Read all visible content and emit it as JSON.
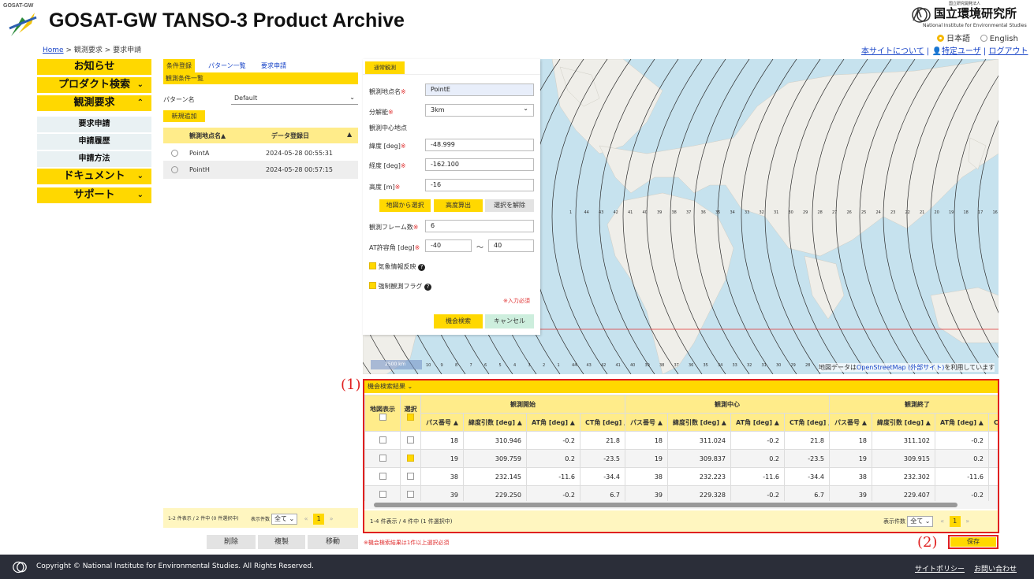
{
  "header": {
    "logo_tag": "GOSAT-GW",
    "title": "GOSAT-GW TANSO-3 Product Archive",
    "breadcrumb": {
      "home": "Home",
      "sep1": " > ",
      "crumb2": "観測要求",
      "sep2": " > ",
      "crumb3": "要求申請"
    },
    "org": {
      "small": "国立研究開発法人",
      "name": "国立環境研究所",
      "en": "National Institute for Environmental Studies"
    },
    "lang": {
      "ja": "日本語",
      "en": "English",
      "selected": "ja"
    },
    "links": {
      "about": "本サイトについて",
      "user": "特定ユーザ",
      "logout": "ログアウト",
      "sep": "|"
    }
  },
  "nav": {
    "notice": "お知らせ",
    "product_search": "プロダクト検索",
    "obs_request": "観測要求",
    "sub": [
      "要求申請",
      "申請履歴",
      "申請方法"
    ],
    "documents": "ドキュメント",
    "support": "サポート"
  },
  "left": {
    "tabs": [
      "条件登録",
      "パターン一覧",
      "要求申請"
    ],
    "section": "観測条件一覧",
    "pattern_label": "パターン名",
    "pattern_value": "Default",
    "new_button": "新規追加",
    "col_name": "観測地点名▲",
    "col_date": "データ登録日",
    "rows": [
      {
        "name": "PointA",
        "date": "2024-05-28 00:55:31"
      },
      {
        "name": "PointH",
        "date": "2024-05-28 00:57:15"
      }
    ],
    "count_text": "1-2 件表示 / 2 件中 (0 件選択中)",
    "per_page_label": "表示件数",
    "per_page_value": "全て",
    "page": "1",
    "buttons": {
      "delete": "削除",
      "copy": "複製",
      "move": "移動"
    }
  },
  "form": {
    "tab": "通常観測",
    "point_name_label": "観測地点名",
    "point_name_value": "PointE",
    "res_label": "分解能",
    "res_value": "3km",
    "center_label": "観測中心地点",
    "lat_label": "緯度 [deg]",
    "lat_value": "-48.999",
    "lon_label": "経度 [deg]",
    "lon_value": "-162.100",
    "alt_label": "高度 [m]",
    "alt_value": "-16",
    "req_mark": "※",
    "btn_map": "地図から選択",
    "btn_alt": "高度算出",
    "btn_clear": "選択を解除",
    "frames_label": "観測フレーム数",
    "frames_value": "6",
    "at_label": "AT許容角 [deg]",
    "at_min": "-40",
    "at_tilde": "〜",
    "at_max": "40",
    "weather_label": "気象情報反映",
    "force_label": "強制観測フラグ",
    "required_note": "※入力必須",
    "btn_search": "機会検索",
    "btn_cancel": "キャンセル"
  },
  "map": {
    "scale": "2500 km",
    "attribution_pre": "地図データは",
    "attribution_link": "OpenStreetMap (外部サイト)",
    "attribution_post": "を利用しています",
    "path_numbers_top": [
      "1",
      "44",
      "43",
      "42",
      "41",
      "40",
      "39",
      "38",
      "37",
      "36",
      "35",
      "34",
      "33",
      "32",
      "31",
      "30",
      "29",
      "28",
      "27",
      "26",
      "25",
      "24",
      "23",
      "22",
      "21",
      "20",
      "19",
      "18",
      "17",
      "16"
    ],
    "path_numbers_bottom": [
      "10",
      "9",
      "8",
      "7",
      "6",
      "5",
      "4",
      "3",
      "2",
      "1",
      "44",
      "43",
      "42",
      "41",
      "40",
      "39",
      "38",
      "37",
      "36",
      "35",
      "34",
      "33",
      "32",
      "31",
      "30",
      "29",
      "28"
    ]
  },
  "results": {
    "marker1": "(1)",
    "marker2": "(2)",
    "title": "機会検索結果",
    "col_map": "地図表示",
    "col_select": "選択",
    "group_start": "観測開始",
    "group_center": "観測中心",
    "group_end": "観測終了",
    "sub_headers": [
      "パス番号 ▲",
      "緯度引数 [deg] ▲",
      "AT角 [deg] ▲",
      "CT角 [deg] ▲",
      "パス番号 ▲",
      "緯度引数 [deg] ▲",
      "AT角 [deg] ▲",
      "CT角 [deg] ▲",
      "パス番号 ▲",
      "緯度引数 [deg] ▲",
      "AT角 [deg] ▲",
      "CT角"
    ],
    "rows": [
      {
        "selected": false,
        "cells": [
          "18",
          "310.946",
          "-0.2",
          "21.8",
          "18",
          "311.024",
          "-0.2",
          "21.8",
          "18",
          "311.102",
          "-0.2",
          ""
        ]
      },
      {
        "selected": true,
        "cells": [
          "19",
          "309.759",
          "0.2",
          "-23.5",
          "19",
          "309.837",
          "0.2",
          "-23.5",
          "19",
          "309.915",
          "0.2",
          ""
        ]
      },
      {
        "selected": false,
        "cells": [
          "38",
          "232.145",
          "-11.6",
          "-34.4",
          "38",
          "232.223",
          "-11.6",
          "-34.4",
          "38",
          "232.302",
          "-11.6",
          ""
        ]
      },
      {
        "selected": false,
        "cells": [
          "39",
          "229.250",
          "-0.2",
          "6.7",
          "39",
          "229.328",
          "-0.2",
          "6.7",
          "39",
          "229.407",
          "-0.2",
          ""
        ]
      }
    ],
    "count_text": "1-4 件表示 / 4 件中 (1 件選択中)",
    "per_page_label": "表示件数",
    "per_page_value": "全て",
    "page": "1",
    "note": "※機会検索結果は1件以上選択必須",
    "save": "保存"
  },
  "footer": {
    "copyright": "Copyright © National Institute for Environmental Studies. All Rights Reserved.",
    "policy": "サイトポリシー",
    "contact": "お問い合わせ"
  },
  "colors": {
    "accent": "#ffd800",
    "highlight": "#e02020",
    "footer": "#2b2e39",
    "link": "#1a46c8"
  }
}
